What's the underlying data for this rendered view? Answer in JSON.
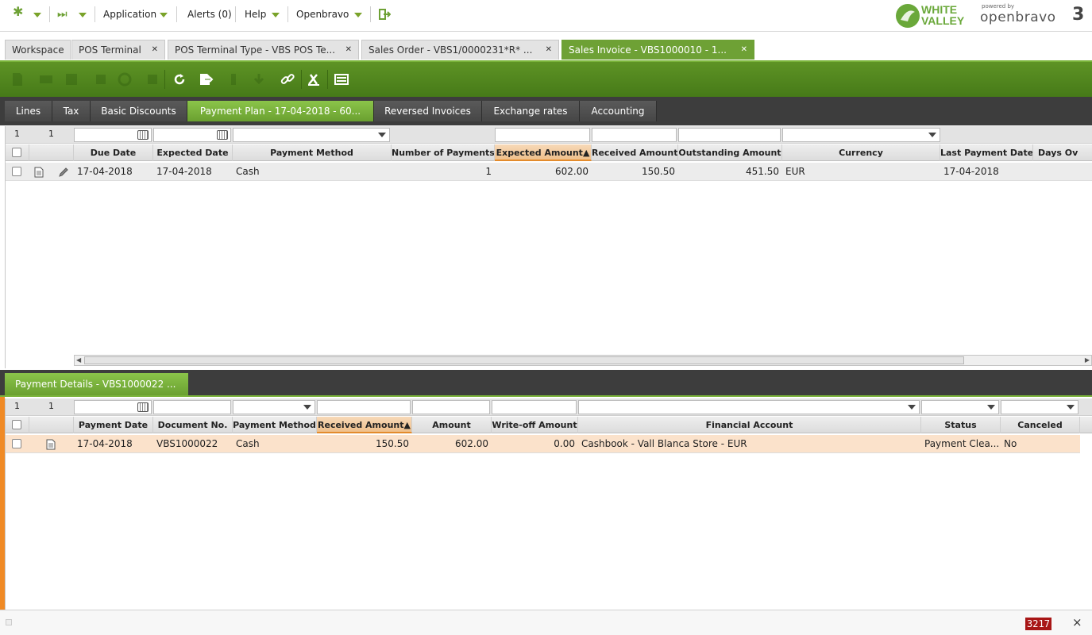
{
  "topnav": {
    "application_label": "Application",
    "alerts_label": "Alerts (0)",
    "help_label": "Help",
    "user_label": "Openbravo"
  },
  "logos": {
    "white_valley": [
      "WHITE",
      "VALLEY"
    ],
    "openbravo_tagline": "powered by",
    "openbravo_name": "openbravo",
    "openbravo_version": "3"
  },
  "tabs": [
    {
      "label": "Workspace",
      "active": false,
      "closable": false
    },
    {
      "label": "POS Terminal",
      "active": false,
      "closable": true
    },
    {
      "label": "POS Terminal Type - VBS POS Te...",
      "active": false,
      "closable": true
    },
    {
      "label": "Sales Order - VBS1/0000231*R* ...",
      "active": false,
      "closable": true
    },
    {
      "label": "Sales Invoice - VBS1000010 - 1...",
      "active": true,
      "closable": true
    }
  ],
  "toolbar_icons": [
    "new-document-icon",
    "new-row-icon",
    "save-icon",
    "save-close-icon",
    "undo-icon",
    "delete-icon",
    "refresh-icon",
    "export-icon",
    "attach-icon",
    "print-icon",
    "link-icon",
    "tools-icon",
    "grid-view-icon"
  ],
  "subtabs": [
    {
      "label": "Lines",
      "active": false
    },
    {
      "label": "Tax",
      "active": false
    },
    {
      "label": "Basic Discounts",
      "active": false
    },
    {
      "label": "Payment Plan - 17-04-2018 - 60...",
      "active": true
    },
    {
      "label": "Reversed Invoices",
      "active": false
    },
    {
      "label": "Exchange rates",
      "active": false
    },
    {
      "label": "Accounting",
      "active": false
    }
  ],
  "payment_plan": {
    "filter": {
      "row_number": "1",
      "count": "1"
    },
    "columns": [
      "Due Date",
      "Expected Date",
      "Payment Method",
      "Number of Payments",
      "Expected Amount",
      "Received Amount",
      "Outstanding Amount",
      "Currency",
      "Last Payment Date",
      "Days Ov"
    ],
    "sorted_column_index": 4,
    "rows": [
      {
        "due_date": "17-04-2018",
        "expected_date": "17-04-2018",
        "payment_method": "Cash",
        "number_of_payments": "1",
        "expected_amount": "602.00",
        "received_amount": "150.50",
        "outstanding_amount": "451.50",
        "currency": "EUR",
        "last_payment_date": "17-04-2018",
        "days_overdue": ""
      }
    ]
  },
  "payment_details": {
    "tab_label": "Payment Details - VBS1000022 ...",
    "filter": {
      "row_number": "1",
      "count": "1"
    },
    "columns": [
      "Payment Date",
      "Document No.",
      "Payment Method",
      "Received Amount",
      "Amount",
      "Write-off Amount",
      "Financial Account",
      "Status",
      "Canceled"
    ],
    "sorted_column_index": 3,
    "rows": [
      {
        "payment_date": "17-04-2018",
        "document_no": "VBS1000022",
        "payment_method": "Cash",
        "received_amount": "150.50",
        "amount": "602.00",
        "writeoff_amount": "0.00",
        "financial_account": "Cashbook - Vall Blanca Store - EUR",
        "status": "Payment Clea...",
        "canceled": "No"
      }
    ]
  },
  "statusbar": {
    "counter": "3217",
    "close_label": "×"
  },
  "colors": {
    "accent_green": "#6ea135",
    "toolbar_green": "#4f861d",
    "selected_row": "#fbe2cb",
    "sorted_header": "#efc08b",
    "counter_red": "#a81616"
  }
}
